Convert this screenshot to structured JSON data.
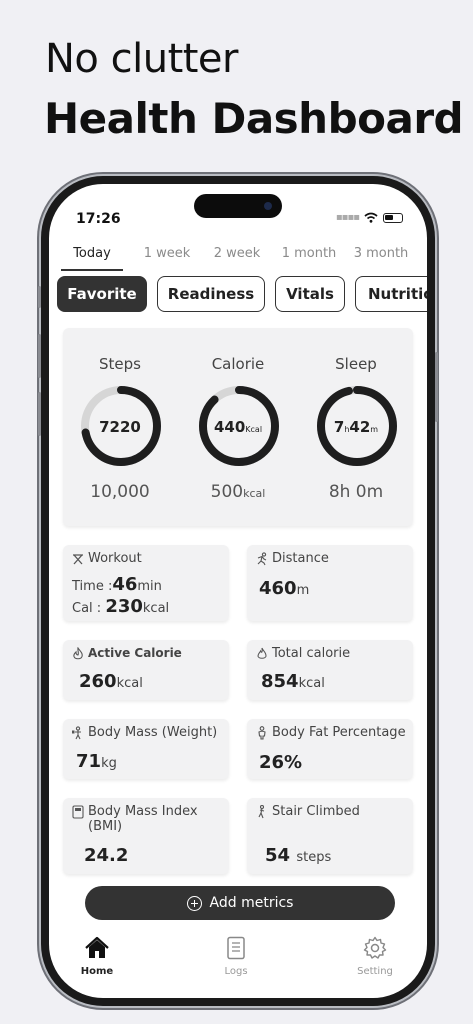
{
  "promo": {
    "headline_line1": "No clutter",
    "headline_line2": "Health Dashboard"
  },
  "status_bar": {
    "time": "17:26",
    "icons": [
      "signal-icon",
      "wifi-icon",
      "battery-icon"
    ]
  },
  "period_tabs": [
    {
      "label": "Today",
      "active": true
    },
    {
      "label": "1 week",
      "active": false
    },
    {
      "label": "2 week",
      "active": false
    },
    {
      "label": "1 month",
      "active": false
    },
    {
      "label": "3 month",
      "active": false
    }
  ],
  "categories": [
    {
      "label": "Favorite",
      "active": true
    },
    {
      "label": "Readiness",
      "active": false
    },
    {
      "label": "Vitals",
      "active": false
    },
    {
      "label": "Nutrition",
      "active": false
    }
  ],
  "rings": [
    {
      "label": "Steps",
      "value": "7220",
      "unit": "",
      "goal": "10,000",
      "goal_unit": "",
      "progress": 0.72
    },
    {
      "label": "Calorie",
      "value": "440",
      "unit": "Kcal",
      "goal": "500",
      "goal_unit": "kcal",
      "progress": 0.88
    },
    {
      "label": "Sleep",
      "value_hours": "7",
      "value_h_unit": "h",
      "value_minutes": "42",
      "value_m_unit": "m",
      "goal": "8h 0m",
      "goal_unit": "",
      "progress": 0.9625
    }
  ],
  "metrics": {
    "workout": {
      "title": "Workout",
      "icon": "workout-icon",
      "time_label": "Time :",
      "time_value": "46",
      "time_unit": "min",
      "cal_label": "Cal :",
      "cal_value": "230",
      "cal_unit": "kcal"
    },
    "distance": {
      "title": "Distance",
      "icon": "running-icon",
      "value": "460",
      "unit": "m"
    },
    "active_calorie": {
      "title": "Active Calorie",
      "icon": "flame-icon",
      "value": "260",
      "unit": "kcal"
    },
    "total_calorie": {
      "title": "Total calorie",
      "icon": "fire-icon",
      "value": "854",
      "unit": "kcal"
    },
    "body_mass": {
      "title": "Body Mass (Weight)",
      "icon": "weight-icon",
      "value": "71",
      "unit": "kg"
    },
    "body_fat": {
      "title": "Body Fat Percentage",
      "icon": "body-icon",
      "value": "26%"
    },
    "bmi": {
      "title": "Body Mass Index (BMI)",
      "icon": "scale-icon",
      "value": "24.2"
    },
    "stairs": {
      "title": "Stair Climbed",
      "icon": "stairs-icon",
      "value": "54",
      "unit": "steps"
    }
  },
  "add_button": {
    "label": "Add metrics"
  },
  "bottom_nav": [
    {
      "label": "Home",
      "icon": "home-icon",
      "active": true
    },
    {
      "label": "Logs",
      "icon": "logs-icon",
      "active": false
    },
    {
      "label": "Setting",
      "icon": "gear-icon",
      "active": false
    }
  ],
  "colors": {
    "accent": "#333333",
    "card": "#f2f2f3",
    "ring_track": "#d6d6d6",
    "background": "#f0f0f4"
  }
}
